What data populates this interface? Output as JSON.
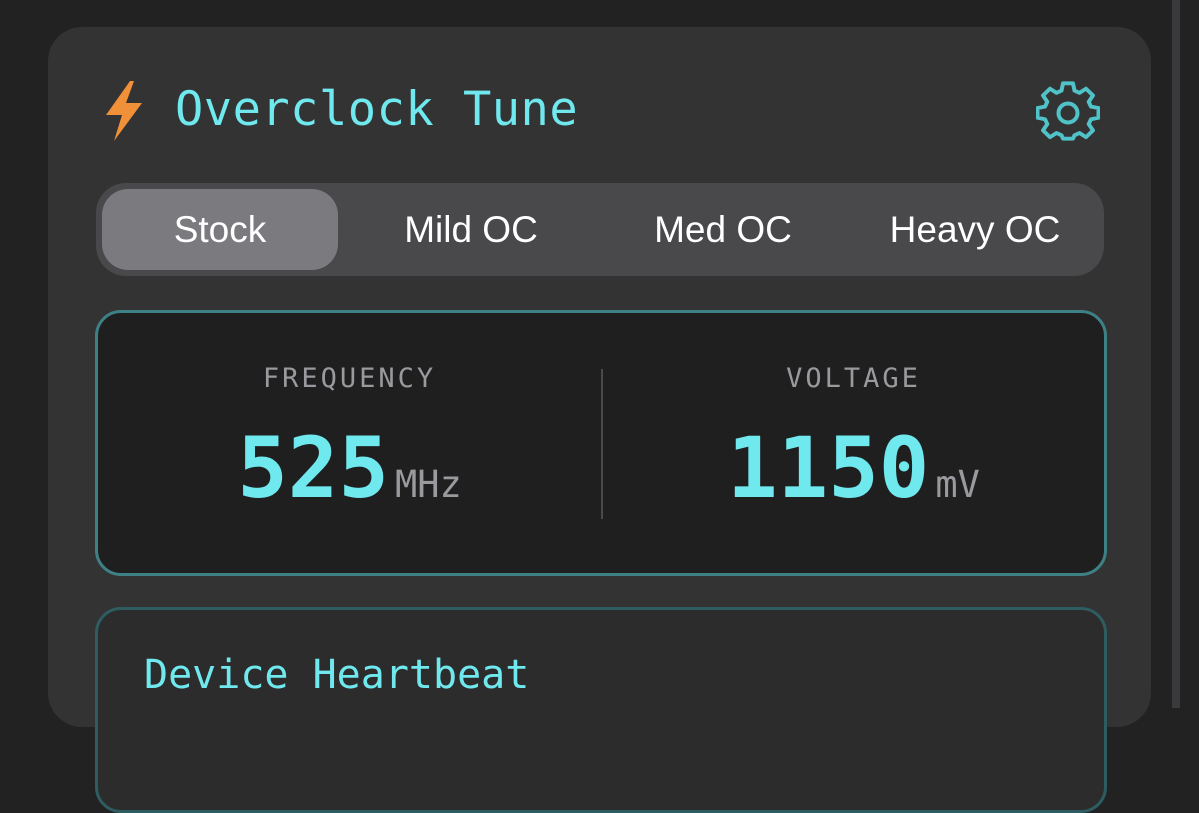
{
  "header": {
    "title": "Overclock Tune",
    "icon": "lightning-bolt-icon",
    "settings_icon": "gear-icon"
  },
  "presets": {
    "selected": "Stock",
    "options": [
      "Stock",
      "Mild OC",
      "Med OC",
      "Heavy OC"
    ]
  },
  "readout": {
    "frequency": {
      "label": "FREQUENCY",
      "value": "525",
      "unit": "MHz"
    },
    "voltage": {
      "label": "VOLTAGE",
      "value": "1150",
      "unit": "mV"
    }
  },
  "heartbeat": {
    "title": "Device Heartbeat"
  },
  "colors": {
    "accent": "#6fe8ee",
    "bolt": "#f0913a",
    "card": "#333334",
    "background": "#222223",
    "readout_border": "#3e8185"
  }
}
